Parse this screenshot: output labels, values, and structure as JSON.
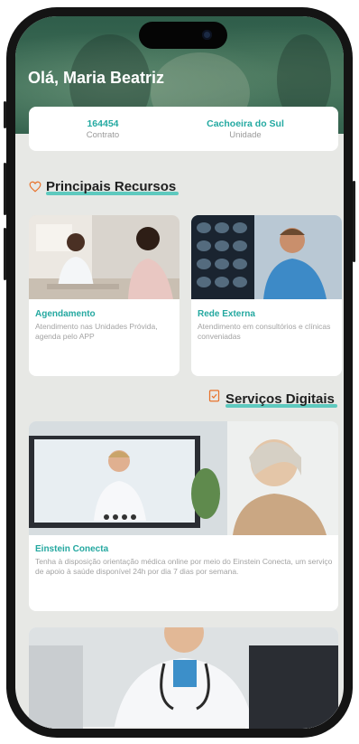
{
  "header": {
    "greeting": "Olá, Maria Beatriz"
  },
  "info": {
    "contract_value": "164454",
    "contract_label": "Contrato",
    "unit_value": "Cachoeira do Sul",
    "unit_label": "Unidade"
  },
  "sections": {
    "resources_title": "Principais Recursos",
    "digital_title": "Serviços Digitais"
  },
  "resources": [
    {
      "title": "Agendamento",
      "desc": "Atendimento nas Unidades Próvida, agenda pelo APP"
    },
    {
      "title": "Rede Externa",
      "desc": "Atendimento em consultórios e clínicas conveniadas"
    }
  ],
  "digital": [
    {
      "title": "Einstein Conecta",
      "desc": "Tenha à disposição orientação médica online por meio do Einstein Conecta, um serviço de apoio à saúde disponível 24h por dia 7 dias por semana."
    }
  ],
  "colors": {
    "accent": "#23a9a1",
    "underline": "#5ec9be",
    "icon": "#e8732c",
    "background": "#e7e8e5"
  },
  "icons": {
    "resources": "heart-icon",
    "digital": "clipboard-check-icon"
  }
}
